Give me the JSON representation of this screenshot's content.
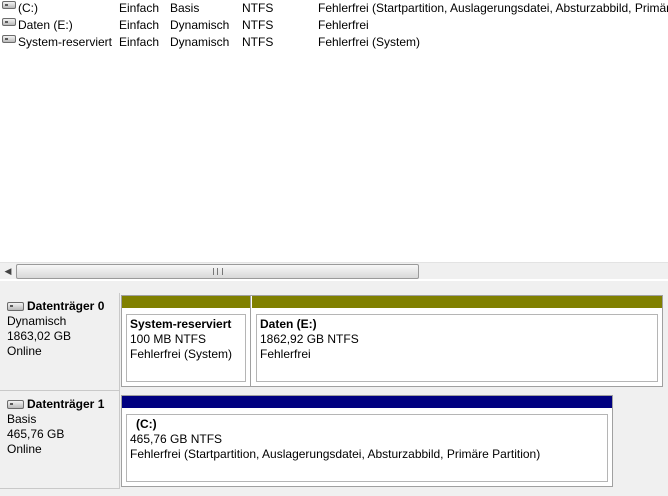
{
  "volumes": [
    {
      "name": "(C:)",
      "layout": "Einfach",
      "type": "Basis",
      "fs": "NTFS",
      "status": "Fehlerfrei (Startpartition, Auslagerungsdatei, Absturzabbild, Primäre"
    },
    {
      "name": "Daten (E:)",
      "layout": "Einfach",
      "type": "Dynamisch",
      "fs": "NTFS",
      "status": "Fehlerfrei"
    },
    {
      "name": "System-reserviert",
      "layout": "Einfach",
      "type": "Dynamisch",
      "fs": "NTFS",
      "status": "Fehlerfrei (System)"
    }
  ],
  "scrollbar": {
    "grip": "III"
  },
  "disks": [
    {
      "title": "Datenträger 0",
      "type": "Dynamisch",
      "size": "1863,02 GB",
      "state": "Online",
      "partitions": [
        {
          "name": "System-reserviert",
          "size": "100 MB NTFS",
          "status": "Fehlerfrei (System)",
          "bar_color": "#808000"
        },
        {
          "name": "Daten  (E:)",
          "size": "1862,92 GB NTFS",
          "status": "Fehlerfrei",
          "bar_color": "#808000"
        }
      ]
    },
    {
      "title": "Datenträger 1",
      "type": "Basis",
      "size": "465,76 GB",
      "state": "Online",
      "partitions": [
        {
          "name": "(C:)",
          "size": "465,76 GB NTFS",
          "status": "Fehlerfrei (Startpartition, Auslagerungsdatei, Absturzabbild, Primäre Partition)",
          "bar_color": "#000080"
        }
      ]
    }
  ]
}
